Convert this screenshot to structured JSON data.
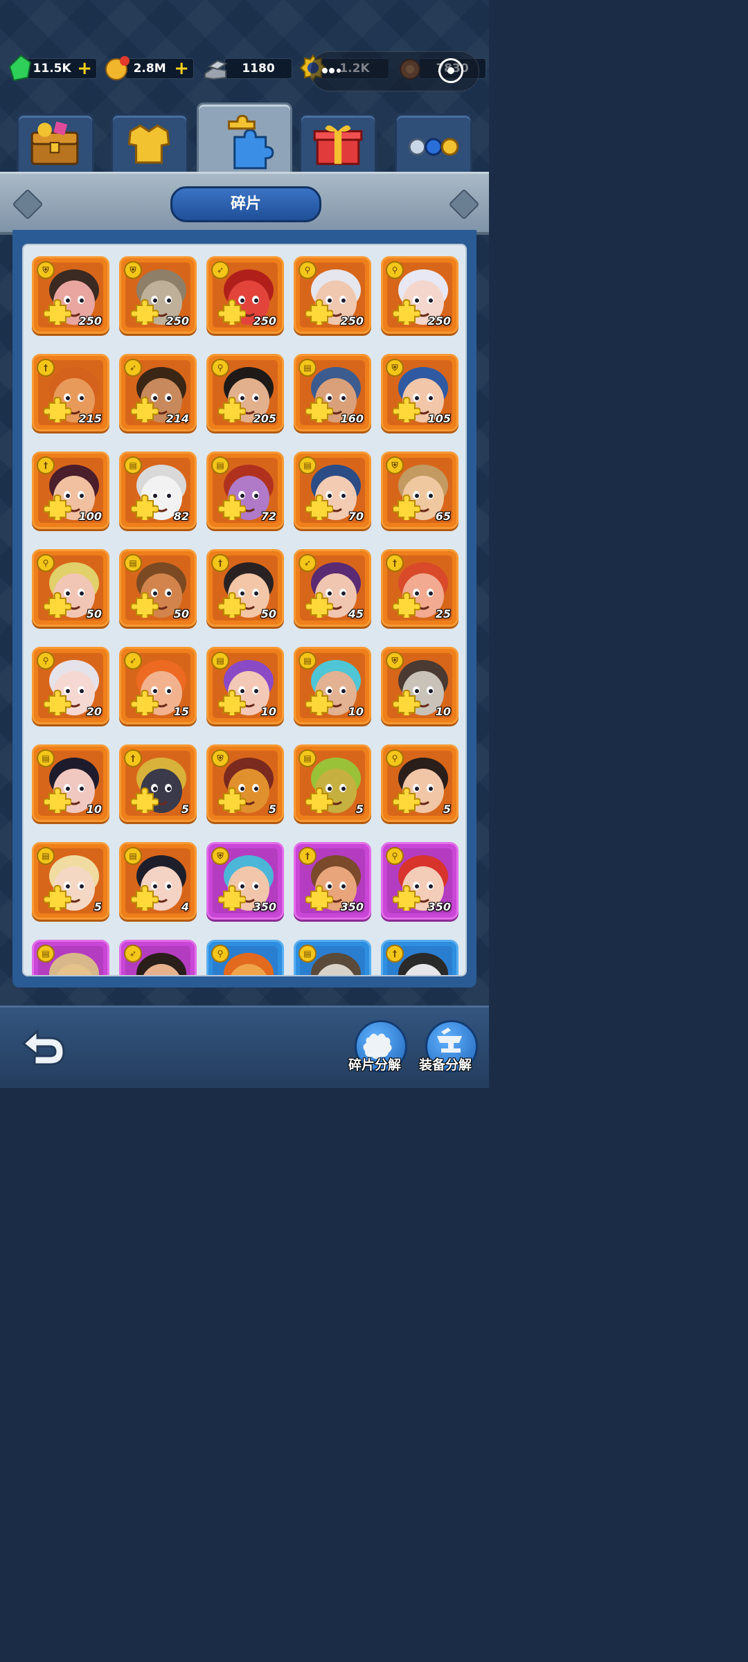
{
  "currencies": [
    {
      "name": "gems",
      "value": "11.5K",
      "has_plus": true,
      "color": "#2ed05a"
    },
    {
      "name": "gold",
      "value": "2.8M",
      "has_plus": true,
      "color": "#f2b62c"
    },
    {
      "name": "iron",
      "value": "1180",
      "has_plus": false,
      "color": "#9aa3ad"
    },
    {
      "name": "medal",
      "value": "1.2K",
      "has_plus": false,
      "color": "#e8b81c"
    },
    {
      "name": "wood",
      "value": "7830",
      "has_plus": false,
      "color": "#9b5a2a"
    }
  ],
  "tabs": [
    {
      "name": "chest-tab",
      "icon": "treasure-chest-icon",
      "active": false
    },
    {
      "name": "equipment-tab",
      "icon": "armor-icon",
      "active": false
    },
    {
      "name": "fragments-tab",
      "icon": "puzzle-pieces-icon",
      "active": true
    },
    {
      "name": "gift-tab",
      "icon": "gift-box-icon",
      "active": false
    },
    {
      "name": "tokens-tab",
      "icon": "tokens-icon",
      "active": false
    }
  ],
  "header": {
    "title": "碎片"
  },
  "heroes": [
    {
      "count": "250",
      "role": "shield",
      "face": "#e9a6a0",
      "hair": "#3a2a22",
      "frame": "orange"
    },
    {
      "count": "250",
      "role": "shield",
      "face": "#bfb09a",
      "hair": "#8e7f68",
      "frame": "orange"
    },
    {
      "count": "250",
      "role": "bow",
      "face": "#e2443c",
      "hair": "#b01f1a",
      "frame": "orange"
    },
    {
      "count": "250",
      "role": "staff",
      "face": "#f0c8b0",
      "hair": "#e6e6ee",
      "frame": "orange"
    },
    {
      "count": "250",
      "role": "staff",
      "face": "#f4d6cc",
      "hair": "#e8e8f4",
      "frame": "orange"
    },
    {
      "count": "215",
      "role": "sword",
      "face": "#e89a5a",
      "hair": "#d4621c",
      "frame": "orange"
    },
    {
      "count": "214",
      "role": "bow",
      "face": "#c88a5c",
      "hair": "#3b2616",
      "frame": "orange"
    },
    {
      "count": "205",
      "role": "staff",
      "face": "#e2b08c",
      "hair": "#1f1a18",
      "frame": "orange"
    },
    {
      "count": "160",
      "role": "book",
      "face": "#d9a07a",
      "hair": "#3c5b8e",
      "frame": "orange"
    },
    {
      "count": "105",
      "role": "shield",
      "face": "#f2c6a8",
      "hair": "#2f5aa2",
      "frame": "orange"
    },
    {
      "count": "100",
      "role": "sword",
      "face": "#f0c0a0",
      "hair": "#4a1e2a",
      "frame": "orange"
    },
    {
      "count": "82",
      "role": "book",
      "face": "#f2f2f2",
      "hair": "#d9d9d9",
      "frame": "orange"
    },
    {
      "count": "72",
      "role": "book",
      "face": "#b07ac8",
      "hair": "#b0321e",
      "frame": "orange"
    },
    {
      "count": "70",
      "role": "book",
      "face": "#f2cbb2",
      "hair": "#2c4c86",
      "frame": "orange"
    },
    {
      "count": "65",
      "role": "shield",
      "face": "#f0c8a0",
      "hair": "#c29a62",
      "frame": "orange"
    },
    {
      "count": "50",
      "role": "staff",
      "face": "#f2c6b4",
      "hair": "#e2d06a",
      "frame": "orange"
    },
    {
      "count": "50",
      "role": "book",
      "face": "#d2844c",
      "hair": "#7c4a22",
      "frame": "orange"
    },
    {
      "count": "50",
      "role": "sword",
      "face": "#f2c6a6",
      "hair": "#2a2222",
      "frame": "orange"
    },
    {
      "count": "45",
      "role": "bow",
      "face": "#f0c6b0",
      "hair": "#5a2a72",
      "frame": "orange"
    },
    {
      "count": "25",
      "role": "sword",
      "face": "#f2aa90",
      "hair": "#d84a2a",
      "frame": "orange"
    },
    {
      "count": "20",
      "role": "staff",
      "face": "#f6d8d2",
      "hair": "#e6e2ea",
      "frame": "orange"
    },
    {
      "count": "15",
      "role": "bow",
      "face": "#f2b28e",
      "hair": "#ec6a22",
      "frame": "orange"
    },
    {
      "count": "10",
      "role": "book",
      "face": "#f4c8b6",
      "hair": "#8a4ac6",
      "frame": "orange"
    },
    {
      "count": "10",
      "role": "book",
      "face": "#e2b292",
      "hair": "#4ec6d6",
      "frame": "orange"
    },
    {
      "count": "10",
      "role": "shield",
      "face": "#c8c2b8",
      "hair": "#4a3a32",
      "frame": "orange"
    },
    {
      "count": "10",
      "role": "book",
      "face": "#f0c8c0",
      "hair": "#1e1c2c",
      "frame": "orange"
    },
    {
      "count": "5",
      "role": "sword",
      "face": "#3a3a4a",
      "hair": "#d8b23a",
      "frame": "orange"
    },
    {
      "count": "5",
      "role": "shield",
      "face": "#e0902c",
      "hair": "#7a2a1e",
      "frame": "orange"
    },
    {
      "count": "5",
      "role": "book",
      "face": "#c6b040",
      "hair": "#9ac238",
      "frame": "orange"
    },
    {
      "count": "5",
      "role": "staff",
      "face": "#f0c6a6",
      "hair": "#2a1e1a",
      "frame": "orange"
    },
    {
      "count": "5",
      "role": "book",
      "face": "#f4d8c4",
      "hair": "#f0dca0",
      "frame": "orange"
    },
    {
      "count": "4",
      "role": "book",
      "face": "#f4d2c4",
      "hair": "#1e1e2a",
      "frame": "orange"
    },
    {
      "count": "350",
      "role": "shield",
      "face": "#f2c6aa",
      "hair": "#4cb6d8",
      "frame": "purple"
    },
    {
      "count": "350",
      "role": "sword",
      "face": "#e8a47a",
      "hair": "#7a4a2a",
      "frame": "purple"
    },
    {
      "count": "350",
      "role": "staff",
      "face": "#f4cdb8",
      "hair": "#d8342c",
      "frame": "purple"
    },
    {
      "count": "",
      "role": "book",
      "face": "#e6c28c",
      "hair": "#d8b88a",
      "frame": "purple"
    },
    {
      "count": "",
      "role": "bow",
      "face": "#e6b28e",
      "hair": "#2a1e1a",
      "frame": "purple"
    },
    {
      "count": "",
      "role": "staff",
      "face": "#f0a44a",
      "hair": "#e26a1e",
      "frame": "blue"
    },
    {
      "count": "",
      "role": "book",
      "face": "#d8d2c8",
      "hair": "#5a4a3a",
      "frame": "blue"
    },
    {
      "count": "",
      "role": "sword",
      "face": "#e6e6ea",
      "hair": "#2a2a2a",
      "frame": "blue"
    }
  ],
  "bottom": {
    "back_icon": "back-arrow-icon",
    "salvage_fragments_label": "碎片分解",
    "salvage_equipment_label": "装备分解"
  }
}
